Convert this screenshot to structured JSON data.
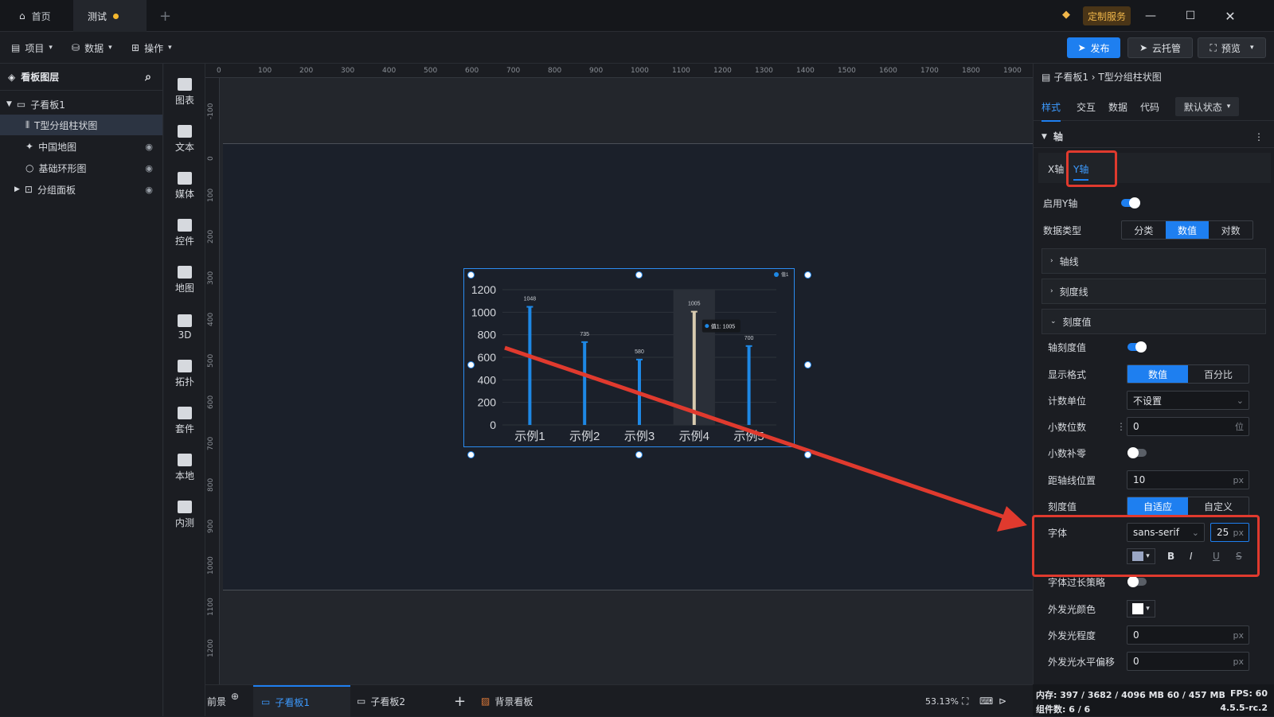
{
  "titlebar": {
    "tabs": [
      {
        "label": "首页",
        "icon": "home-icon"
      },
      {
        "label": "测试",
        "icon": "unsaved-dot-icon"
      }
    ],
    "custom_service": "定制服务"
  },
  "menubar": {
    "menus": [
      "项目",
      "数据",
      "操作"
    ],
    "publish": "发布",
    "cloud": "云托管",
    "preview": "预览"
  },
  "layers": {
    "title": "看板图层",
    "items": [
      {
        "label": "子看板1",
        "icon": "board-icon"
      },
      {
        "label": "T型分组柱状图",
        "icon": "bar-chart-icon"
      },
      {
        "label": "中国地图",
        "icon": "map-icon"
      },
      {
        "label": "基础环形图",
        "icon": "ring-chart-icon"
      },
      {
        "label": "分组面板",
        "icon": "panel-icon"
      }
    ]
  },
  "toolbox": [
    "图表",
    "文本",
    "媒体",
    "控件",
    "地图",
    "3D",
    "拓扑",
    "套件",
    "本地",
    "内测"
  ],
  "ruler": {
    "top": [
      "0",
      "100",
      "200",
      "300",
      "400",
      "500",
      "600",
      "700",
      "800",
      "900",
      "1000",
      "1100",
      "1200",
      "1300",
      "1400",
      "1500",
      "1600",
      "1700",
      "1800",
      "1900"
    ],
    "left": [
      "-100",
      "0",
      "100",
      "200",
      "300",
      "400",
      "500",
      "600",
      "700",
      "800",
      "900",
      "1000",
      "1100",
      "1200"
    ]
  },
  "chart_data": {
    "type": "bar",
    "categories": [
      "示例1",
      "示例2",
      "示例3",
      "示例4",
      "示例5"
    ],
    "series": [
      {
        "name": "值1",
        "values": [
          1048,
          735,
          580,
          1005,
          700
        ]
      }
    ],
    "ylim": [
      0,
      1200
    ],
    "yticks": [
      "0",
      "200",
      "400",
      "600",
      "800",
      "1000",
      "1200"
    ],
    "highlight_index": 3,
    "tooltip": "值1: 1005",
    "legend_label": "值1",
    "bar_color": "#1e88e5",
    "highlight_color": "#d8cbb0"
  },
  "bottombar": {
    "foreground": "前景",
    "tabs": [
      "子看板1",
      "子看板2"
    ],
    "background": "背景看板",
    "zoom": "53.13%"
  },
  "properties": {
    "breadcrumb": "子看板1 › T型分组柱状图",
    "tabs": [
      "样式",
      "交互",
      "数据",
      "代码"
    ],
    "state": "默认状态",
    "section": "轴",
    "axis_tabs": [
      "X轴",
      "Y轴"
    ],
    "enable_y": "启用Y轴",
    "data_type": {
      "label": "数据类型",
      "options": [
        "分类",
        "数值",
        "对数"
      ]
    },
    "axis_line": "轴线",
    "tick_line": "刻度线",
    "tick_value": "刻度值",
    "show_tick": "轴刻度值",
    "display_format": {
      "label": "显示格式",
      "options": [
        "数值",
        "百分比"
      ]
    },
    "unit": {
      "label": "计数单位",
      "value": "不设置"
    },
    "decimals": {
      "label": "小数位数",
      "value": "0",
      "unit": "位"
    },
    "zero_pad": "小数补零",
    "distance": {
      "label": "距轴线位置",
      "value": "10",
      "unit": "px"
    },
    "tick_mode": {
      "label": "刻度值",
      "options": [
        "自适应",
        "自定义"
      ]
    },
    "font": {
      "label": "字体",
      "family": "sans-serif",
      "size": "25",
      "unit": "px",
      "styles": [
        "B",
        "I",
        "U",
        "S"
      ]
    },
    "overflow": "字体过长策略",
    "glow_color": "外发光颜色",
    "glow_level": {
      "label": "外发光程度",
      "value": "0",
      "unit": "px"
    },
    "glow_offset": {
      "label": "外发光水平偏移",
      "value": "0",
      "unit": "px"
    }
  },
  "status": {
    "memory": "内存: 397 / 3682 / 4096 MB  60 / 457 MB",
    "fps": "FPS: 60",
    "components": "组件数: 6 / 6",
    "version": "4.5.5-rc.2"
  },
  "colors": {
    "accent": "#1e7ff0",
    "annotation": "#e03a2e"
  }
}
